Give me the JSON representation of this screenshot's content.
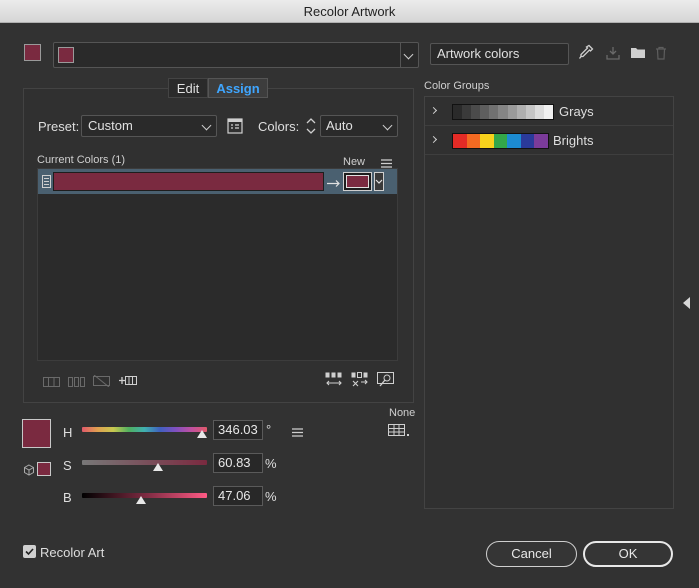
{
  "window": {
    "title": "Recolor Artwork"
  },
  "colors": {
    "artwork": "#7a2a40",
    "bg": "#323232"
  },
  "top": {
    "group_name_placeholder": "",
    "artwork_colors_value": "Artwork colors"
  },
  "tabs": {
    "edit": "Edit",
    "assign": "Assign",
    "active": "Assign"
  },
  "assign": {
    "preset_label": "Preset:",
    "preset_value": "Custom",
    "colors_label": "Colors:",
    "colors_value": "Auto",
    "current_colors_label": "Current Colors (1)",
    "new_label": "New"
  },
  "hsb": {
    "h_label": "H",
    "h_value": "346.03",
    "h_unit": "°",
    "s_label": "S",
    "s_value": "60.83",
    "s_unit": "%",
    "b_label": "B",
    "b_value": "47.06",
    "b_unit": "%",
    "h_fraction": 0.9612,
    "s_fraction": 0.6083,
    "b_fraction": 0.4706
  },
  "none_label": "None",
  "color_groups": {
    "label": "Color Groups",
    "items": [
      {
        "name": "Grays",
        "swatches": [
          "#2a2a2a",
          "#3a3a3a",
          "#4b4b4b",
          "#5e5e5e",
          "#717171",
          "#858585",
          "#9a9a9a",
          "#afafaf",
          "#c5c5c5",
          "#dcdcdc",
          "#f0f0f0"
        ]
      },
      {
        "name": "Brights",
        "swatches": [
          "#e42b26",
          "#f36a22",
          "#f8d21c",
          "#33a74a",
          "#1c8bd2",
          "#2a3a9a",
          "#7b3b9a"
        ]
      }
    ]
  },
  "footer": {
    "recolor_art_label": "Recolor Art",
    "recolor_art_checked": true,
    "cancel": "Cancel",
    "ok": "OK"
  }
}
